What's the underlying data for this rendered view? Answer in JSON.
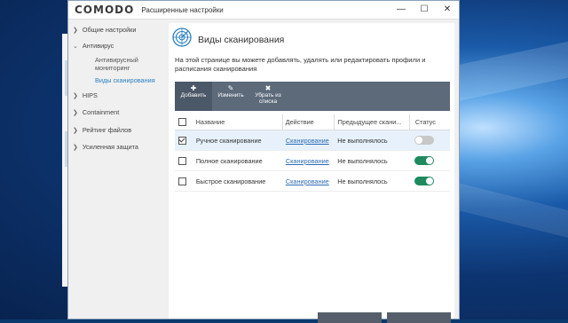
{
  "window": {
    "brand": "COMODO",
    "title": "Расширенные настройки",
    "controls": {
      "minimize": "—",
      "maximize": "☐",
      "close": "✕"
    }
  },
  "sidebar": {
    "items": [
      {
        "label": "Общие настройки",
        "expanded": false
      },
      {
        "label": "Антивирус",
        "expanded": true
      },
      {
        "label": "Антивирусный"
      },
      {
        "label": "мониторинг"
      },
      {
        "label": "Виды сканирования",
        "active": true
      },
      {
        "label": "HIPS",
        "expanded": false
      },
      {
        "label": "Containment",
        "expanded": false
      },
      {
        "label": "Рейтинг файлов",
        "expanded": false
      },
      {
        "label": "Усиленная защита",
        "expanded": false
      }
    ]
  },
  "panel": {
    "title": "Виды сканирования",
    "description": "На этой странице вы можете добавлять, удалять или редактировать профили и расписания сканирования",
    "toolbar": {
      "add": {
        "icon": "✚",
        "label": "Добавить"
      },
      "edit": {
        "icon": "✎",
        "label": "Изменить"
      },
      "remove": {
        "icon": "✖",
        "label1": "Убрать из",
        "label2": "списка"
      }
    },
    "table": {
      "headers": {
        "name": "Название",
        "action": "Действие",
        "last": "Предыдущее скани...",
        "status": "Статус"
      },
      "rows": [
        {
          "checked": true,
          "name": "Ручное сканирование",
          "action": "Сканирование",
          "last": "Не выполнялось",
          "enabled": false
        },
        {
          "checked": false,
          "name": "Полное сканирование",
          "action": "Сканирование",
          "last": "Не выполнялось",
          "enabled": true
        },
        {
          "checked": false,
          "name": "Быстрое сканирование",
          "action": "Сканирование",
          "last": "Не выполнялось",
          "enabled": true
        }
      ]
    }
  },
  "colors": {
    "accent": "#2a7fc1",
    "toolbar": "#5c6a7a",
    "toggle_on": "#1f8a5e",
    "toggle_off": "#c8c8c8",
    "link": "#2d6cb5"
  },
  "icons": {
    "section": "radar-scan-icon",
    "chevron": "chevron-right-icon",
    "chevron_open": "chevron-down-icon"
  }
}
